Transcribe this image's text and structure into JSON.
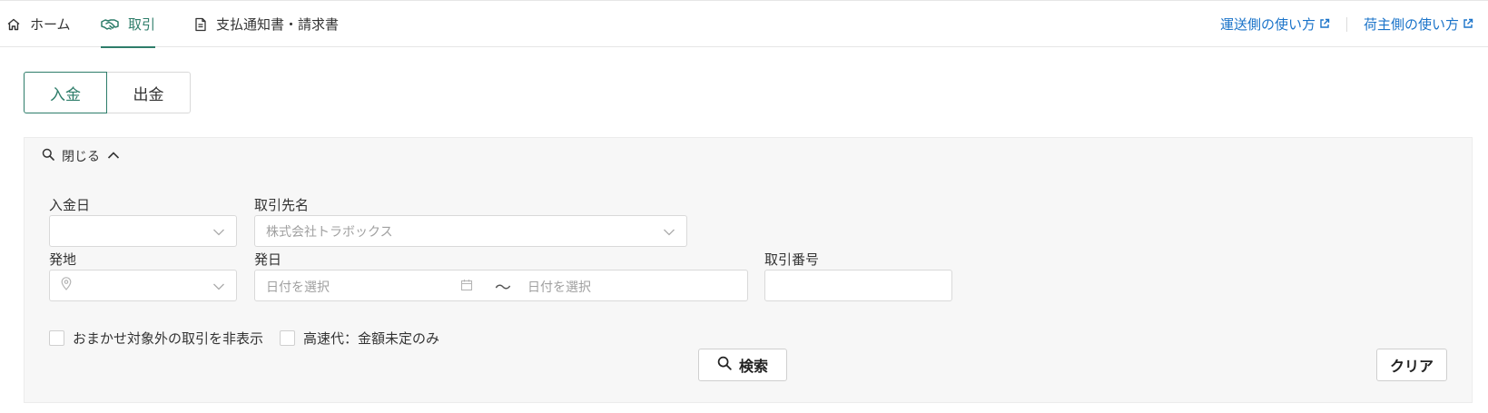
{
  "nav": {
    "items": [
      {
        "label": "ホーム",
        "icon": "home-icon"
      },
      {
        "label": "取引",
        "icon": "handshake-icon",
        "active": true
      },
      {
        "label": "支払通知書・請求書",
        "icon": "document-icon"
      }
    ],
    "help_links": [
      {
        "label": "運送側の使い方",
        "icon": "external-link-icon"
      },
      {
        "label": "荷主側の使い方",
        "icon": "external-link-icon"
      }
    ],
    "accent_color": "#2e7d6a",
    "link_color": "#1a73c9"
  },
  "toggle": {
    "options": [
      "入金",
      "出金"
    ],
    "selected": "入金"
  },
  "search_panel": {
    "toggle_label": "閉じる",
    "fields": {
      "payment_date": {
        "label": "入金日",
        "value": ""
      },
      "partner": {
        "label": "取引先名",
        "placeholder": "株式会社トラボックス"
      },
      "origin": {
        "label": "発地",
        "value": ""
      },
      "departure_date": {
        "label": "発日",
        "from_placeholder": "日付を選択",
        "separator": "～",
        "to_placeholder": "日付を選択"
      },
      "transaction_no": {
        "label": "取引番号",
        "value": ""
      }
    },
    "checkboxes": [
      {
        "label": "おまかせ対象外の取引を非表示",
        "checked": false
      },
      {
        "label": "高速代：金額未定のみ",
        "checked": false
      }
    ],
    "search_button": "検索",
    "clear_button": "クリア"
  }
}
